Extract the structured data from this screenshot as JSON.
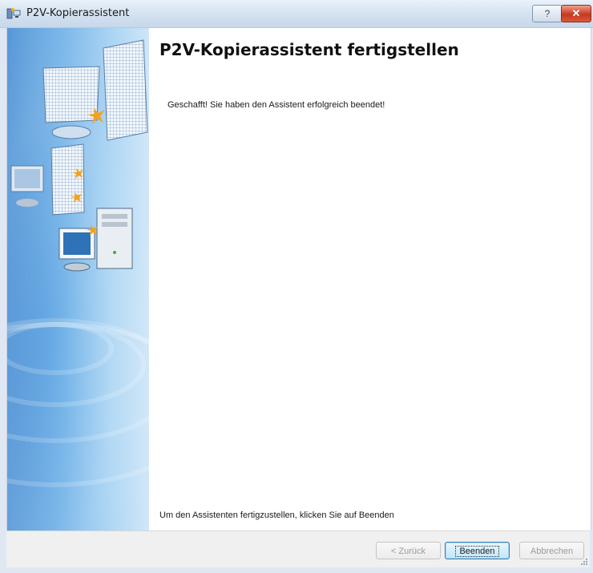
{
  "window": {
    "title": "P2V-Kopierassistent",
    "help_label": "?",
    "close_label": "✕"
  },
  "page": {
    "title": "P2V-Kopierassistent fertigstellen",
    "success_message": "Geschafft! Sie haben den Assistent erfolgreich beendet!",
    "finish_hint": "Um den Assistenten fertigzustellen, klicken Sie auf Beenden"
  },
  "buttons": {
    "back": "< Zurück",
    "finish": "Beenden",
    "cancel": "Abbrechen"
  },
  "icons": {
    "app": "p2v-wizard-icon",
    "side": "servers-network-illustration"
  }
}
